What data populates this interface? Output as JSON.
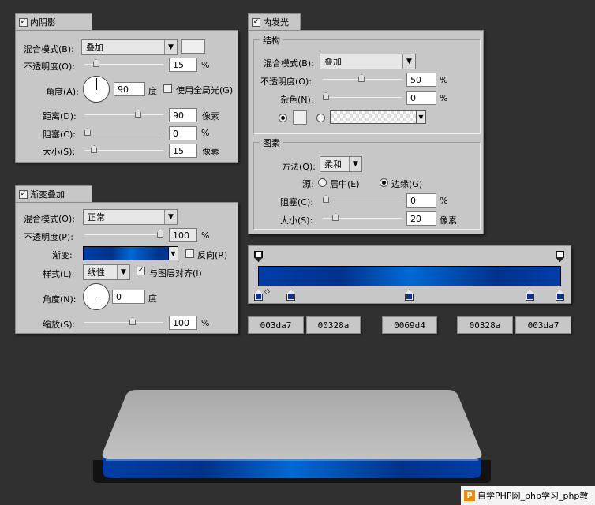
{
  "inner_shadow": {
    "title": "内阴影",
    "blend_mode_label": "混合模式(B):",
    "blend_mode_value": "叠加",
    "opacity_label": "不透明度(O):",
    "opacity_value": "15",
    "opacity_fraction": 0.15,
    "angle_label": "角度(A):",
    "angle_value": "90",
    "angle_unit": "度",
    "global_light_label": "使用全局光(G)",
    "distance_label": "距离(D):",
    "distance_value": "90",
    "distance_unit": "像素",
    "choke_label": "阻塞(C):",
    "choke_value": "0",
    "size_label": "大小(S):",
    "size_value": "15",
    "size_unit": "像素",
    "percent": "%"
  },
  "inner_glow": {
    "title": "内发光",
    "structure_title": "结构",
    "blend_mode_label": "混合模式(B):",
    "blend_mode_value": "叠加",
    "opacity_label": "不透明度(O):",
    "opacity_value": "50",
    "noise_label": "杂色(N):",
    "noise_value": "0",
    "elements_title": "图素",
    "method_label": "方法(Q):",
    "method_value": "柔和",
    "source_label": "源:",
    "center_label": "居中(E)",
    "edge_label": "边缘(G)",
    "choke_label": "阻塞(C):",
    "choke_value": "0",
    "size_label": "大小(S):",
    "size_value": "20",
    "size_unit": "像素",
    "percent": "%"
  },
  "gradient_overlay": {
    "title": "渐变叠加",
    "blend_mode_label": "混合模式(O):",
    "blend_mode_value": "正常",
    "opacity_label": "不透明度(P):",
    "opacity_value": "100",
    "gradient_label": "渐变:",
    "reverse_label": "反向(R)",
    "style_label": "样式(L):",
    "style_value": "线性",
    "align_label": "与图层对齐(I)",
    "angle_label": "角度(N):",
    "angle_value": "0",
    "angle_unit": "度",
    "scale_label": "缩放(S):",
    "scale_value": "100",
    "percent": "%"
  },
  "color_stops": [
    "003da7",
    "00328a",
    "0069d4",
    "00328a",
    "003da7"
  ],
  "colors": {
    "stop_1": "#003da7",
    "stop_2": "#00328a",
    "stop_3": "#0069d4"
  },
  "watermark": "自学PHP网_php学习_php教"
}
